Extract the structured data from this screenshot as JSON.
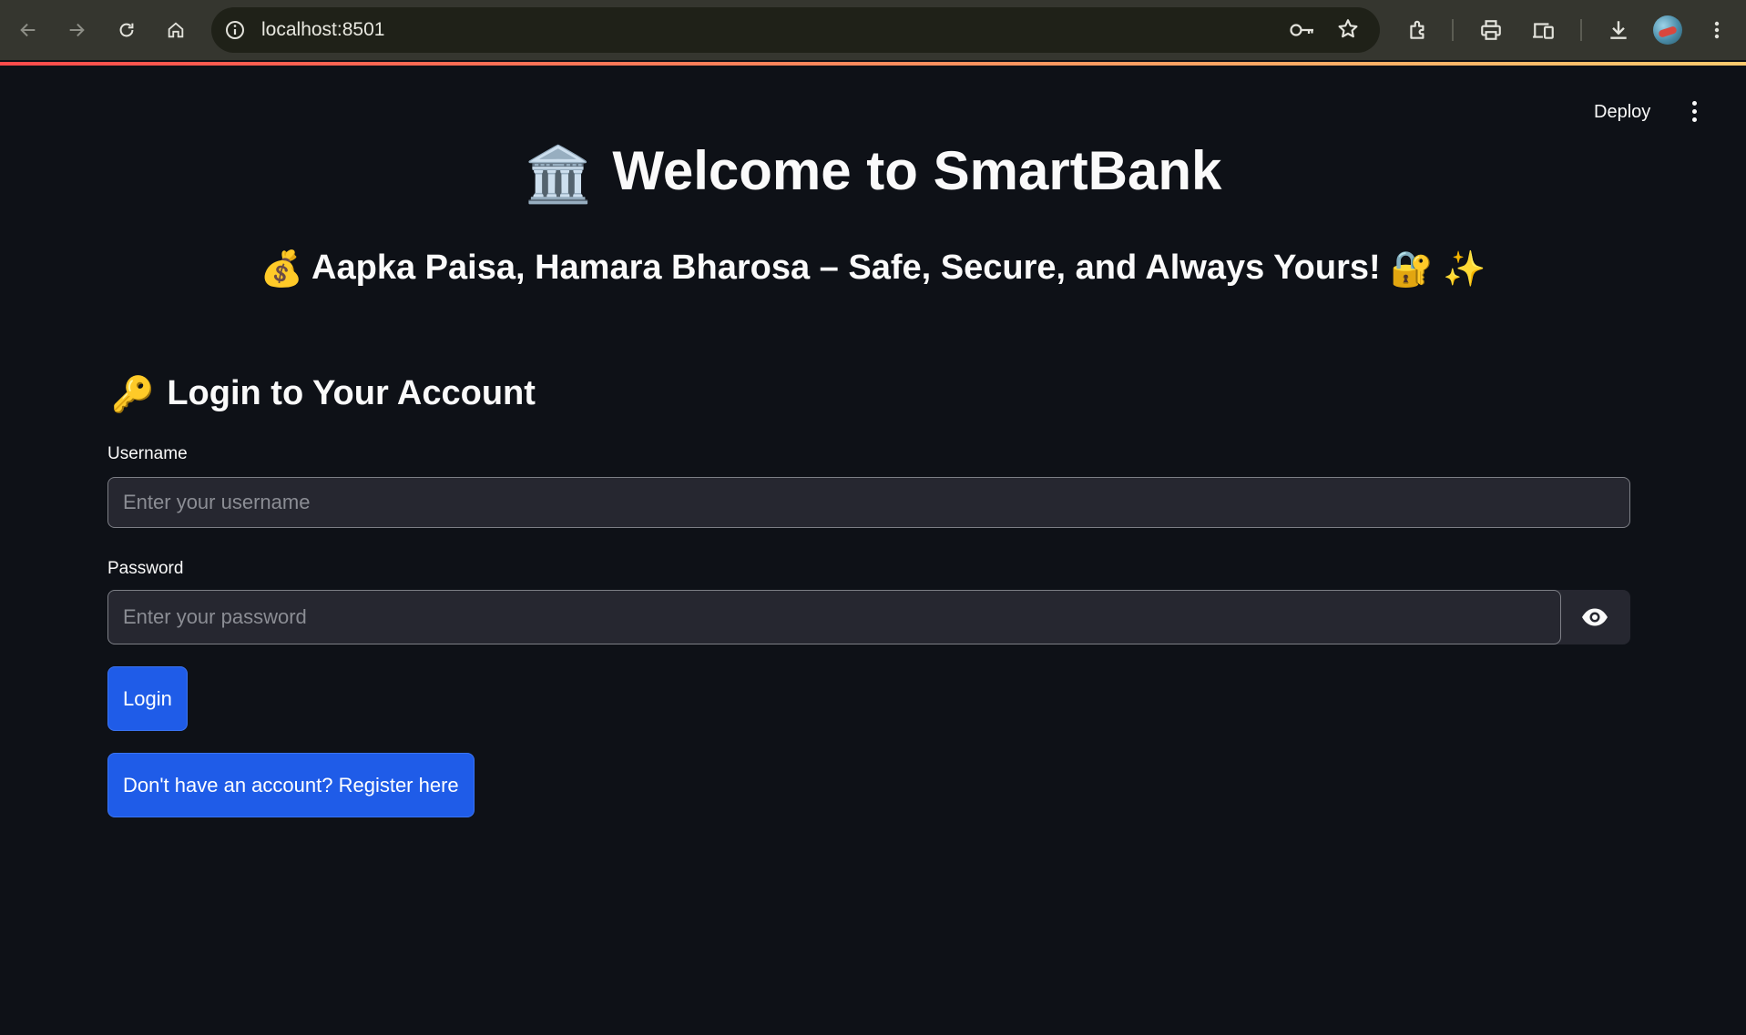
{
  "browser": {
    "url": "localhost:8501",
    "icons": [
      "back-icon",
      "forward-icon",
      "reload-icon",
      "home-icon",
      "site-info-icon",
      "password-key-icon",
      "bookmark-star-icon",
      "extensions-icon",
      "print-icon",
      "device-toggle-icon",
      "download-icon",
      "profile-avatar",
      "browser-menu-icon"
    ]
  },
  "header": {
    "deploy_label": "Deploy"
  },
  "main": {
    "title_emoji": "🏛️",
    "title": "Welcome to SmartBank",
    "tagline_emoji_start": "💰",
    "tagline": "Aapka Paisa, Hamara Bharosa – Safe, Secure, and Always Yours!",
    "tagline_emoji_end": "🔐 ✨",
    "login_section": {
      "emoji": "🔑",
      "title": "Login to Your Account",
      "username_label": "Username",
      "username_placeholder": "Enter your username",
      "username_value": "",
      "password_label": "Password",
      "password_placeholder": "Enter your password",
      "password_value": "",
      "login_button": "Login",
      "register_button": "Don't have an account? Register here"
    }
  },
  "colors": {
    "background": "#0e1117",
    "input_background": "#262730",
    "primary_button": "#1f5ce8",
    "accent_gradient_start": "#ff4b4b",
    "accent_gradient_end": "#fdcb6e"
  }
}
